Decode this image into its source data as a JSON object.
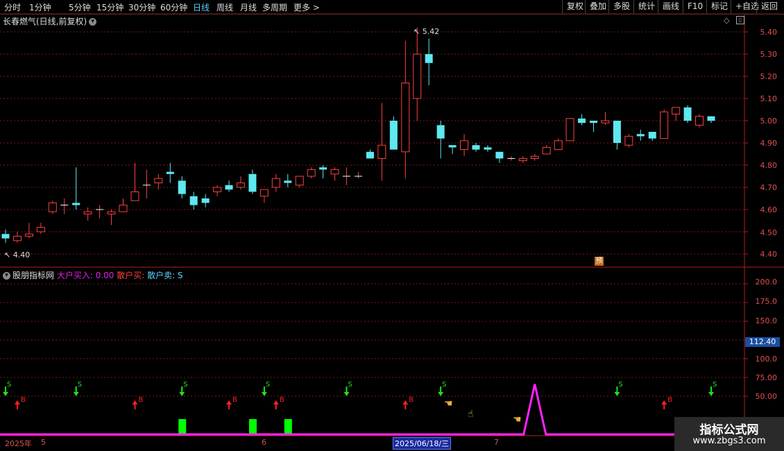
{
  "toolbar": {
    "periods": [
      "分时",
      "1分钟",
      "5分钟",
      "15分钟",
      "30分钟",
      "60分钟",
      "日线",
      "周线",
      "月线",
      "多周期",
      "更多 >"
    ],
    "active_period": "日线",
    "right_buttons": [
      "复权",
      "叠加",
      "多股",
      "统计",
      "画线",
      "F10",
      "标记",
      "+自选",
      "返回"
    ]
  },
  "stock": {
    "title": "长春燃气(日线,前复权)"
  },
  "price_axis": [
    "5.40",
    "5.30",
    "5.20",
    "5.10",
    "5.00",
    "4.90",
    "4.80",
    "4.70",
    "4.60",
    "4.50",
    "4.40"
  ],
  "annotations": {
    "high": "5.42",
    "low": "4.40",
    "pred_label": "预"
  },
  "indicator": {
    "name": "股朋指标网",
    "big_buy_label": "大户买入:",
    "big_buy_value": "0.00",
    "retail_buy_label": "散户买:",
    "retail_sell_label": "散户卖:",
    "retail_sell_value": "S",
    "axis": [
      "200.0",
      "175.0",
      "150.0",
      "125.0",
      "100.0",
      "75.00",
      "50.00"
    ],
    "current_value": "112.40",
    "buy_mark": "B",
    "sell_mark": "S"
  },
  "dates": {
    "year": "2025年",
    "m5": "5",
    "m6": "6",
    "highlight": "2025/06/18/三",
    "m7": "7"
  },
  "watermark": {
    "line1": "指标公式网",
    "line2": "www.zbgs3.com"
  },
  "colors": {
    "up": "#ff4040",
    "down": "#5ee8f0",
    "grid": "#7a1a1a",
    "magenta": "#ff22ff",
    "green": "#00ff00"
  },
  "chart_data": {
    "type": "candlestick",
    "ylim": [
      4.36,
      5.46
    ],
    "candles": [
      {
        "o": 4.49,
        "h": 4.51,
        "l": 4.45,
        "c": 4.47
      },
      {
        "o": 4.46,
        "h": 4.5,
        "l": 4.45,
        "c": 4.48
      },
      {
        "o": 4.48,
        "h": 4.54,
        "l": 4.47,
        "c": 4.49
      },
      {
        "o": 4.5,
        "h": 4.54,
        "l": 4.49,
        "c": 4.52
      },
      {
        "o": 4.59,
        "h": 4.64,
        "l": 4.58,
        "c": 4.63
      },
      {
        "o": 4.62,
        "h": 4.65,
        "l": 4.58,
        "c": 4.62
      },
      {
        "o": 4.63,
        "h": 4.79,
        "l": 4.6,
        "c": 4.62
      },
      {
        "o": 4.58,
        "h": 4.61,
        "l": 4.55,
        "c": 4.59
      },
      {
        "o": 4.6,
        "h": 4.62,
        "l": 4.56,
        "c": 4.6
      },
      {
        "o": 4.58,
        "h": 4.6,
        "l": 4.53,
        "c": 4.59
      },
      {
        "o": 4.59,
        "h": 4.65,
        "l": 4.59,
        "c": 4.62
      },
      {
        "o": 4.64,
        "h": 4.81,
        "l": 4.64,
        "c": 4.68
      },
      {
        "o": 4.71,
        "h": 4.78,
        "l": 4.65,
        "c": 4.71
      },
      {
        "o": 4.72,
        "h": 4.76,
        "l": 4.69,
        "c": 4.74
      },
      {
        "o": 4.77,
        "h": 4.81,
        "l": 4.72,
        "c": 4.76
      },
      {
        "o": 4.73,
        "h": 4.75,
        "l": 4.65,
        "c": 4.67
      },
      {
        "o": 4.66,
        "h": 4.68,
        "l": 4.6,
        "c": 4.62
      },
      {
        "o": 4.65,
        "h": 4.67,
        "l": 4.61,
        "c": 4.63
      },
      {
        "o": 4.68,
        "h": 4.71,
        "l": 4.66,
        "c": 4.7
      },
      {
        "o": 4.71,
        "h": 4.73,
        "l": 4.68,
        "c": 4.69
      },
      {
        "o": 4.7,
        "h": 4.75,
        "l": 4.69,
        "c": 4.72
      },
      {
        "o": 4.76,
        "h": 4.78,
        "l": 4.67,
        "c": 4.68
      },
      {
        "o": 4.66,
        "h": 4.69,
        "l": 4.63,
        "c": 4.69
      },
      {
        "o": 4.7,
        "h": 4.76,
        "l": 4.68,
        "c": 4.74
      },
      {
        "o": 4.73,
        "h": 4.76,
        "l": 4.7,
        "c": 4.72
      },
      {
        "o": 4.71,
        "h": 4.74,
        "l": 4.7,
        "c": 4.75
      },
      {
        "o": 4.75,
        "h": 4.79,
        "l": 4.74,
        "c": 4.78
      },
      {
        "o": 4.79,
        "h": 4.8,
        "l": 4.74,
        "c": 4.78
      },
      {
        "o": 4.76,
        "h": 4.79,
        "l": 4.73,
        "c": 4.78
      },
      {
        "o": 4.75,
        "h": 4.79,
        "l": 4.71,
        "c": 4.75
      },
      {
        "o": 4.75,
        "h": 4.77,
        "l": 4.74,
        "c": 4.75
      },
      {
        "o": 4.86,
        "h": 4.87,
        "l": 4.83,
        "c": 4.83
      },
      {
        "o": 4.83,
        "h": 5.08,
        "l": 4.73,
        "c": 4.89
      },
      {
        "o": 5.0,
        "h": 5.02,
        "l": 4.87,
        "c": 4.87
      },
      {
        "o": 4.86,
        "h": 5.36,
        "l": 4.74,
        "c": 5.17
      },
      {
        "o": 5.1,
        "h": 5.42,
        "l": 5.0,
        "c": 5.3
      },
      {
        "o": 5.3,
        "h": 5.37,
        "l": 5.16,
        "c": 5.26
      },
      {
        "o": 4.98,
        "h": 5.0,
        "l": 4.83,
        "c": 4.92
      },
      {
        "o": 4.89,
        "h": 4.89,
        "l": 4.85,
        "c": 4.88
      },
      {
        "o": 4.87,
        "h": 4.94,
        "l": 4.84,
        "c": 4.91
      },
      {
        "o": 4.89,
        "h": 4.9,
        "l": 4.86,
        "c": 4.87
      },
      {
        "o": 4.88,
        "h": 4.89,
        "l": 4.86,
        "c": 4.87
      },
      {
        "o": 4.86,
        "h": 4.86,
        "l": 4.81,
        "c": 4.83
      },
      {
        "o": 4.83,
        "h": 4.84,
        "l": 4.82,
        "c": 4.83
      },
      {
        "o": 4.82,
        "h": 4.84,
        "l": 4.81,
        "c": 4.83
      },
      {
        "o": 4.83,
        "h": 4.85,
        "l": 4.82,
        "c": 4.84
      },
      {
        "o": 4.85,
        "h": 4.89,
        "l": 4.85,
        "c": 4.88
      },
      {
        "o": 4.87,
        "h": 4.92,
        "l": 4.87,
        "c": 4.91
      },
      {
        "o": 4.91,
        "h": 5.01,
        "l": 4.91,
        "c": 5.01
      },
      {
        "o": 5.01,
        "h": 5.03,
        "l": 4.98,
        "c": 4.99
      },
      {
        "o": 5.0,
        "h": 5.0,
        "l": 4.95,
        "c": 4.99
      },
      {
        "o": 4.99,
        "h": 5.04,
        "l": 4.98,
        "c": 5.0
      },
      {
        "o": 5.0,
        "h": 5.0,
        "l": 4.87,
        "c": 4.9
      },
      {
        "o": 4.89,
        "h": 4.94,
        "l": 4.88,
        "c": 4.93
      },
      {
        "o": 4.94,
        "h": 4.96,
        "l": 4.91,
        "c": 4.93
      },
      {
        "o": 4.95,
        "h": 4.95,
        "l": 4.91,
        "c": 4.92
      },
      {
        "o": 4.92,
        "h": 5.05,
        "l": 4.92,
        "c": 5.04
      },
      {
        "o": 5.03,
        "h": 5.06,
        "l": 5.0,
        "c": 5.06
      },
      {
        "o": 5.06,
        "h": 5.07,
        "l": 4.99,
        "c": 5.0
      },
      {
        "o": 4.98,
        "h": 5.03,
        "l": 4.97,
        "c": 5.02
      },
      {
        "o": 5.02,
        "h": 5.02,
        "l": 4.99,
        "c": 5.0
      }
    ],
    "signals": [
      {
        "i": 0,
        "type": "S"
      },
      {
        "i": 1,
        "type": "B"
      },
      {
        "i": 6,
        "type": "S"
      },
      {
        "i": 11,
        "type": "B"
      },
      {
        "i": 15,
        "type": "S"
      },
      {
        "i": 19,
        "type": "B"
      },
      {
        "i": 22,
        "type": "S"
      },
      {
        "i": 23,
        "type": "B"
      },
      {
        "i": 29,
        "type": "S"
      },
      {
        "i": 34,
        "type": "B"
      },
      {
        "i": 37,
        "type": "S"
      },
      {
        "i": 52,
        "type": "S"
      },
      {
        "i": 56,
        "type": "B"
      },
      {
        "i": 60,
        "type": "S"
      }
    ],
    "indicator_axis_range": [
      20,
      210
    ],
    "green_bars": [
      15,
      21,
      24
    ],
    "peak_index": 45,
    "peak_value": 66
  }
}
